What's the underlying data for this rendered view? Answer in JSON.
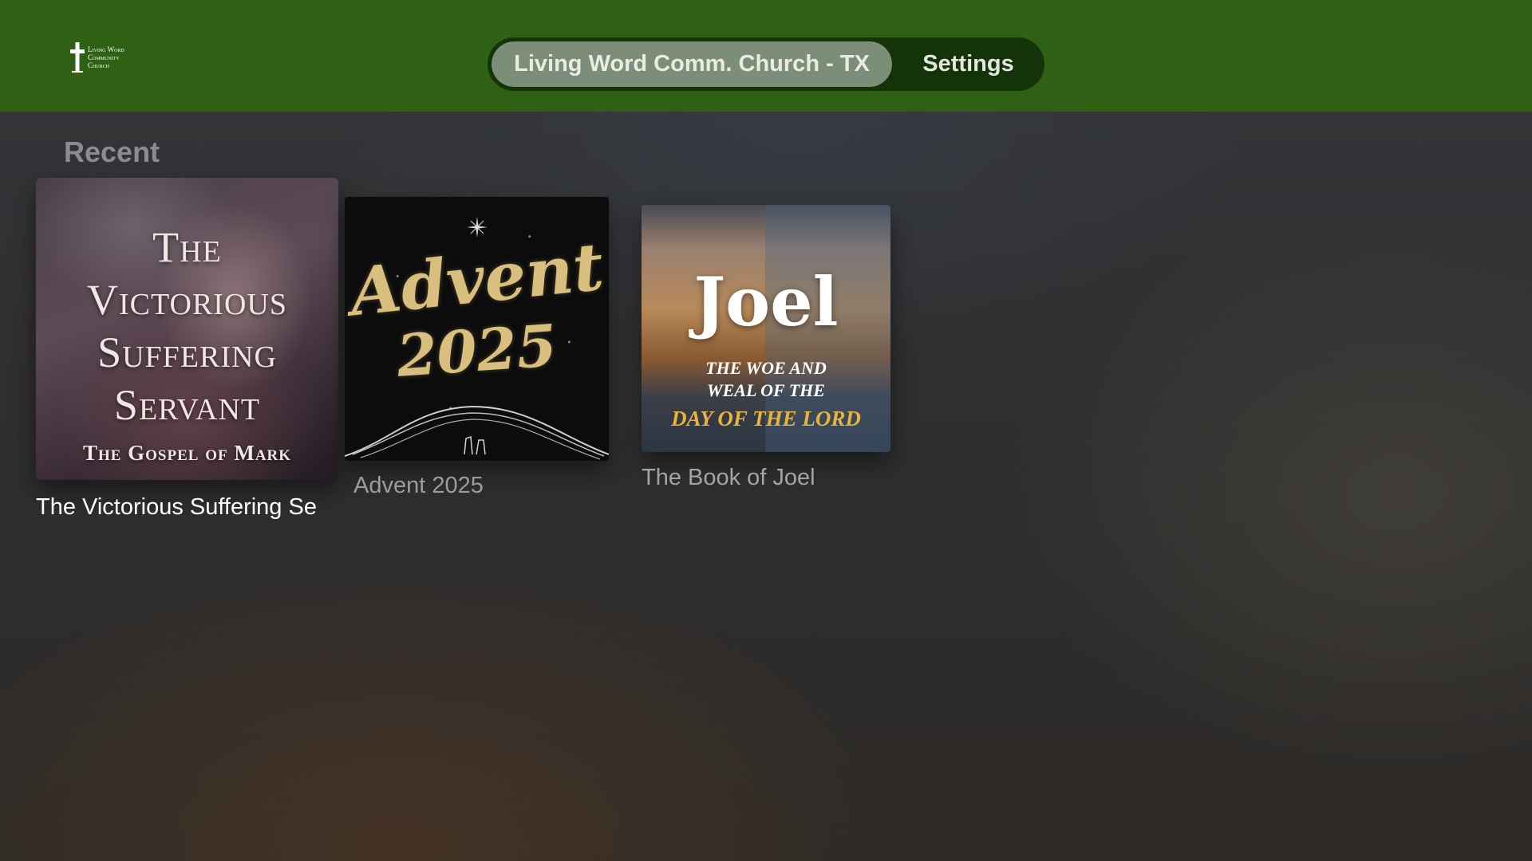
{
  "header": {
    "logo": {
      "icon": "cross-icon",
      "text": [
        "Living Word",
        "Community",
        "Church"
      ]
    },
    "tabs": [
      {
        "label": "Living Word Comm. Church - TX",
        "selected": true
      },
      {
        "label": "Settings",
        "selected": false
      }
    ]
  },
  "main": {
    "section_title": "Recent",
    "items": [
      {
        "title": "The Victorious Suffering Se",
        "focused": true,
        "artwork_text": [
          "The",
          "Victorious",
          "Suffering",
          "Servant",
          "The Gospel of Mark"
        ]
      },
      {
        "title": "Advent 2025",
        "focused": false,
        "artwork_text": [
          "Advent",
          "2025"
        ]
      },
      {
        "title": "The Book of Joel",
        "focused": false,
        "artwork_text": [
          "Joel",
          "The Woe and",
          "Weal of the",
          "Day of the Lord"
        ]
      }
    ]
  },
  "colors": {
    "header_bg": "#2e6114",
    "tabbar_bg": "#153309",
    "tab_selected_bg": "#7d8e78",
    "joel_accent": "#e8b43c",
    "advent_gold": "#d8bf7e"
  }
}
